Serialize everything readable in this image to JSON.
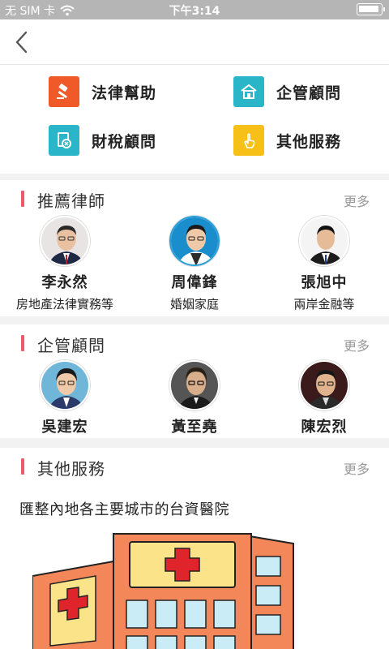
{
  "status_bar": {
    "carrier": "无 SIM 卡",
    "time": "下午3:14"
  },
  "services": [
    {
      "label": "法律幫助",
      "icon": "gavel-icon",
      "color": "#f05a28"
    },
    {
      "label": "企管顧問",
      "icon": "house-icon",
      "color": "#2ab5c8"
    },
    {
      "label": "財稅顧問",
      "icon": "finance-doc-icon",
      "color": "#2ab5c8"
    },
    {
      "label": "其他服務",
      "icon": "hand-pointer-icon",
      "color": "#f7c019"
    }
  ],
  "lawyers": {
    "title": "推薦律師",
    "more": "更多",
    "people": [
      {
        "name": "李永然",
        "spec": "房地產法律實務等"
      },
      {
        "name": "周偉鋒",
        "spec": "婚姻家庭"
      },
      {
        "name": "張旭中",
        "spec": "兩岸金融等"
      }
    ]
  },
  "consultants": {
    "title": "企管顧問",
    "more": "更多",
    "people": [
      {
        "name": "吳建宏"
      },
      {
        "name": "黃至堯"
      },
      {
        "name": "陳宏烈"
      }
    ]
  },
  "other": {
    "title": "其他服務",
    "more": "更多",
    "description": "匯整內地各主要城市的台資醫院"
  },
  "colors": {
    "accent_bar": "#ef5a6b",
    "hospital_orange": "#f3875a",
    "hospital_yellow": "#fbe38a",
    "window_blue": "#c9ecf6",
    "cross_red": "#e0242b"
  }
}
